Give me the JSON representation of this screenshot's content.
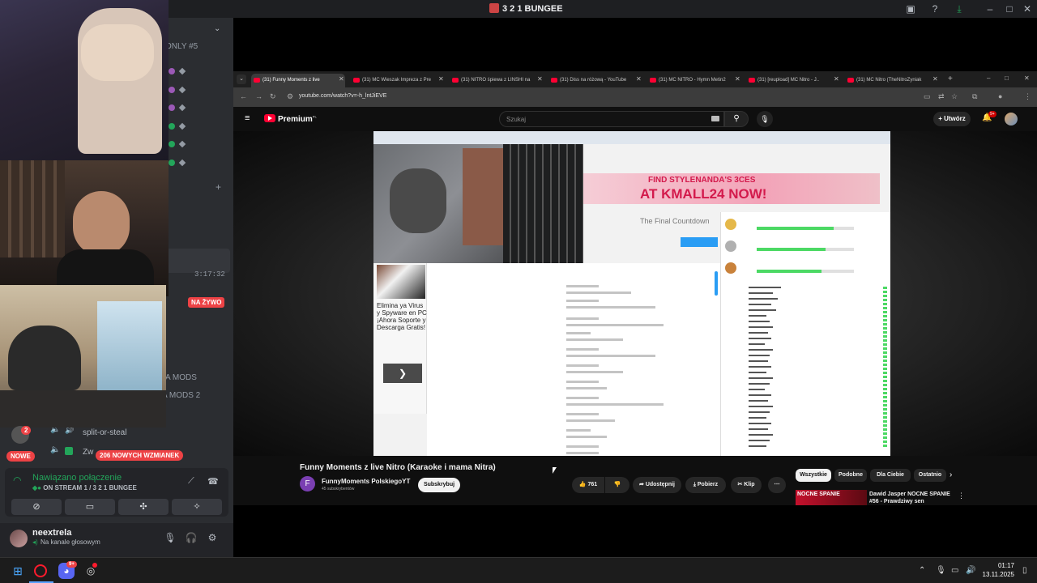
{
  "discord": {
    "window_title": "3 2 1 BUNGEE",
    "channel_header": "ONLY #5",
    "stream_timer": "3:17:32",
    "live_badge": "NA ŻYWO",
    "mods_1": "A MODS",
    "mods_2": "A MODS 2",
    "voice_channel": "split-or-steal",
    "voice_channel_2": "Zw",
    "new_badge": "NOWE",
    "new_messages": "206 NOWYCH WZMIANEK",
    "unread_count": "2",
    "connection_status": "Nawiązano połączenie",
    "connection_sub": "ON STREAM 1 / 3 2 1 BUNGEE",
    "username": "neextrela",
    "user_status": "Na kanale głosowym"
  },
  "browser": {
    "tabs": [
      {
        "label": "(31) Funny Moments z live",
        "active": true
      },
      {
        "label": "(31) MC Wieszak Impreza z Pre",
        "active": false
      },
      {
        "label": "(31) NITRO śpiewa z LINSHI na",
        "active": false
      },
      {
        "label": "(31) Diss na różową - YouTube",
        "active": false
      },
      {
        "label": "(31) MC NITRO - Hymn Metin2",
        "active": false
      },
      {
        "label": "(31) [reupload] MC Nitro - J..",
        "active": false
      },
      {
        "label": "(31) MC Nitro (TheNitroZyniak",
        "active": false
      }
    ],
    "url": "youtube.com/watch?v=-h_lntJiEVE"
  },
  "youtube": {
    "logo": "Premium",
    "logo_region": "PL",
    "search_placeholder": "Szukaj",
    "create_label": "Utwórz",
    "notification_count": "9+",
    "video_title": "Funny Moments z live Nitro (Karaoke i mama Nitra)",
    "channel_initial": "F",
    "channel_name": "FunnyMoments PolskiegoYT",
    "channel_subs": "45 subskrybentów",
    "subscribe_label": "Subskrybuj",
    "like_count": "761",
    "share_label": "Udostępnij",
    "download_label": "Pobierz",
    "clip_label": "Klip",
    "chips": [
      "Wszystkie",
      "Podobne",
      "Dla Ciebie",
      "Ostatnio"
    ],
    "rec_thumb_text": "NOCNE SPANIE",
    "rec_title": "Dawid Jasper NOCNE SPANIE #56 - Prawdziwy sen"
  },
  "video_frame": {
    "banner_line1": "FIND STYLENANDA'S 3CES",
    "banner_line2": "AT KMALL24 NOW!",
    "final_countdown": "The Final Countdown",
    "ad_text": "Elimina ya Virus y Spyware en PC ¡Ahora Soporte y Descarga Gratis!"
  },
  "taskbar": {
    "time": "01:17",
    "date": "13.11.2025",
    "discord_badge": "9+"
  }
}
